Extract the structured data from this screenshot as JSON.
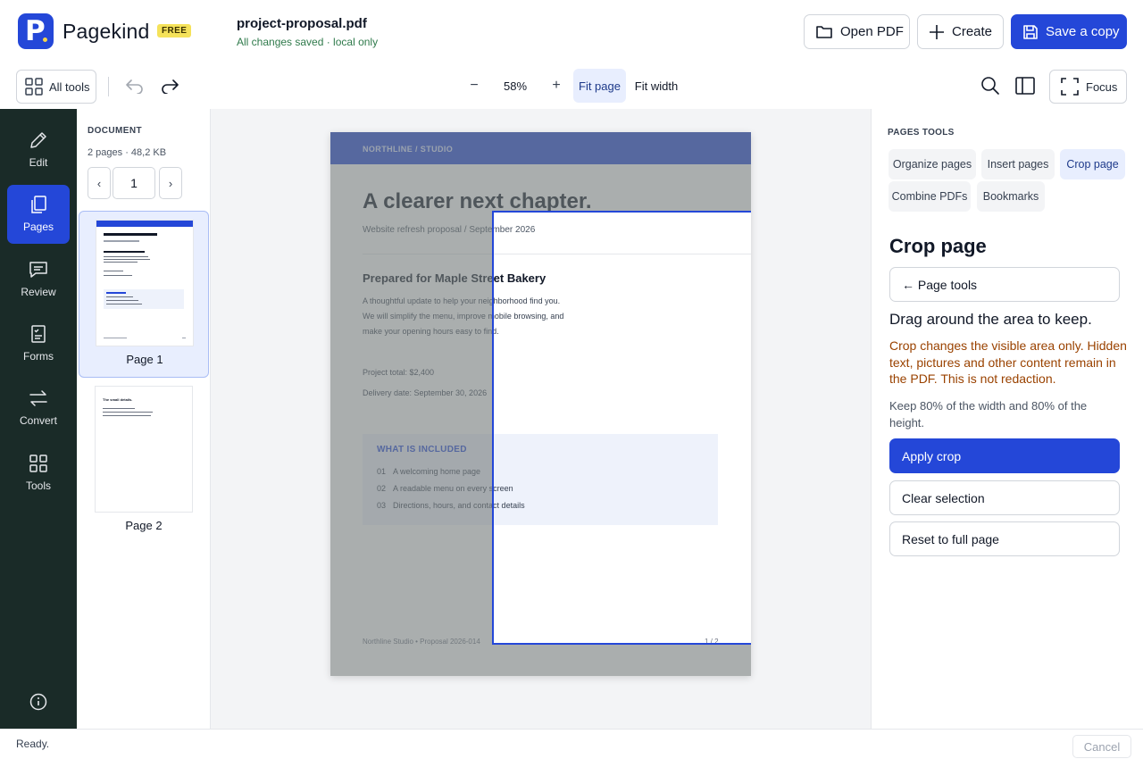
{
  "app": {
    "name": "Pagekind",
    "badge": "FREE"
  },
  "file": {
    "name": "project-proposal.pdf",
    "status": "All changes saved · local only"
  },
  "header": {
    "open_label": "Open PDF",
    "create_label": "Create",
    "save_label": "Save a copy"
  },
  "toolbar": {
    "all_tools": "All tools",
    "zoom_out": "−",
    "zoom_value": "58%",
    "zoom_in": "+",
    "fit_page": "Fit page",
    "fit_width": "Fit width",
    "focus": "Focus"
  },
  "rail": {
    "items": [
      {
        "label": "Edit",
        "icon": "pencil-icon"
      },
      {
        "label": "Pages",
        "icon": "pages-icon"
      },
      {
        "label": "Review",
        "icon": "comment-icon"
      },
      {
        "label": "Forms",
        "icon": "form-icon"
      },
      {
        "label": "Convert",
        "icon": "convert-icon"
      },
      {
        "label": "Tools",
        "icon": "grid-icon"
      }
    ],
    "active": "Pages"
  },
  "thumbnails": {
    "section": "DOCUMENT",
    "meta": "2 pages · 48,2 KB",
    "prev": "‹",
    "next": "›",
    "current_page": "1",
    "pages": [
      {
        "label": "Page 1"
      },
      {
        "label": "Page 2"
      }
    ]
  },
  "page": {
    "header": "NORTHLINE / STUDIO",
    "title": "A clearer next chapter.",
    "subtitle": "Website refresh proposal  /  September 2026",
    "prepared": "Prepared for Maple Street Bakery",
    "intro": [
      "A thoughtful update to help your neighborhood find you.",
      "We will simplify the menu, improve mobile browsing, and",
      "make your opening hours easy to find."
    ],
    "total": "Project total: $2,400",
    "delivery": "Delivery date: September 30, 2026",
    "included_title": "WHAT IS INCLUDED",
    "included": [
      {
        "n": "01",
        "text": "A welcoming home page"
      },
      {
        "n": "02",
        "text": "A readable menu on every screen"
      },
      {
        "n": "03",
        "text": "Directions, hours, and contact details"
      }
    ],
    "footer_left": "Northline Studio  •  Proposal 2026-014",
    "footer_right": "1 / 2"
  },
  "page2": {
    "title": "The small details."
  },
  "right_panel": {
    "section": "PAGES TOOLS",
    "chips": [
      "Organize pages",
      "Insert pages",
      "Crop page",
      "Combine PDFs",
      "Bookmarks"
    ],
    "active_chip": "Crop page",
    "title": "Crop page",
    "back": "← Page tools",
    "instruction": "Drag around the area to keep.",
    "warning": "Crop changes the visible area only. Hidden text, pictures and other content remain in the PDF. This is not redaction.",
    "keep": "Keep 80% of the width and 80% of the height.",
    "apply": "Apply crop",
    "clear": "Clear selection",
    "reset": "Reset to full page"
  },
  "crop": {
    "width_pct": 80,
    "height_pct": 80
  },
  "status": {
    "text": "Ready.",
    "cancel": "Cancel"
  },
  "colors": {
    "accent": "#2447d8",
    "rail_bg": "#1a2b28",
    "warning": "#9a4200",
    "badge": "#f5e25a"
  }
}
